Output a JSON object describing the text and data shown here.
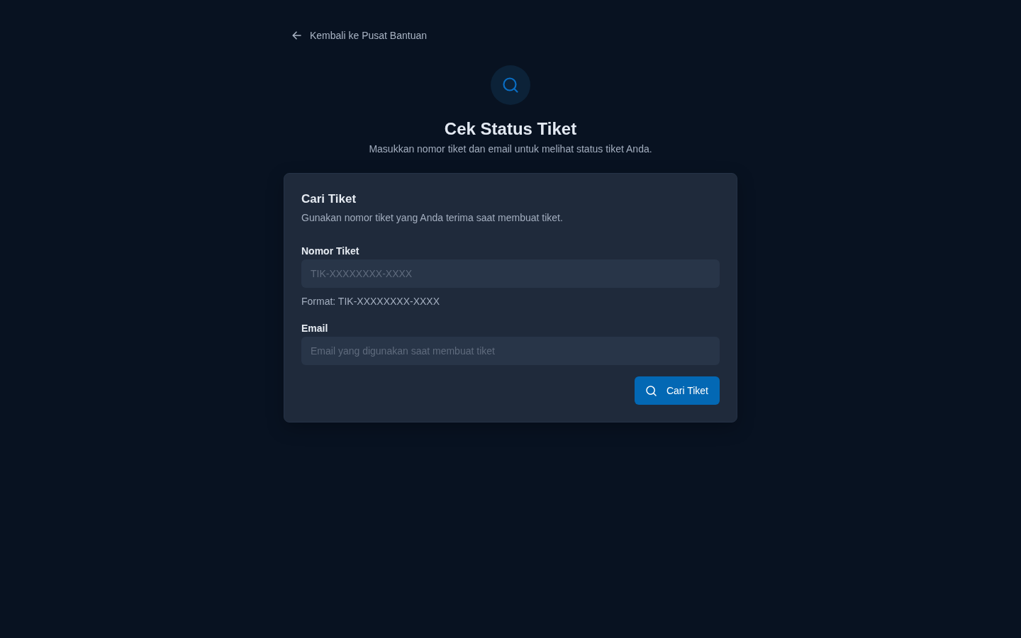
{
  "back_link": {
    "label": "Kembali ke Pusat Bantuan"
  },
  "header": {
    "title": "Cek Status Tiket",
    "subtitle": "Masukkan nomor tiket dan email untuk melihat status tiket Anda."
  },
  "card": {
    "title": "Cari Tiket",
    "description": "Gunakan nomor tiket yang Anda terima saat membuat tiket.",
    "fields": [
      {
        "label": "Nomor Tiket",
        "placeholder": "TIK-XXXXXXXX-XXXX",
        "hint": "Format: TIK-XXXXXXXX-XXXX"
      },
      {
        "label": "Email",
        "placeholder": "Email yang digunakan saat membuat tiket"
      }
    ],
    "submit": {
      "label": "Cari Tiket"
    }
  }
}
